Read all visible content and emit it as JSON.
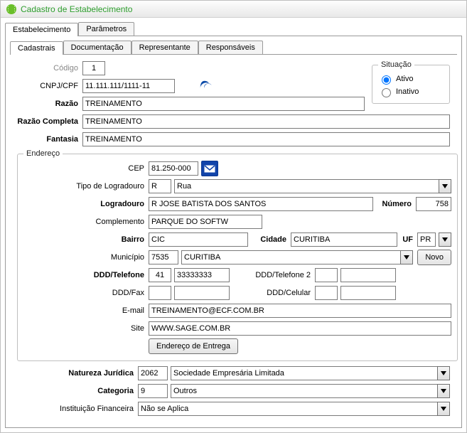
{
  "window": {
    "title": "Cadastro de Estabelecimento"
  },
  "outer_tabs": {
    "estabelecimento": "Estabelecimento",
    "parametros": "Parâmetros"
  },
  "inner_tabs": {
    "cadastrais": "Cadastrais",
    "documentacao": "Documentação",
    "representante": "Representante",
    "responsaveis": "Responsáveis"
  },
  "labels": {
    "codigo": "Código",
    "cnpj": "CNPJ/CPF",
    "razao": "Razão",
    "razao_completa": "Razão Completa",
    "fantasia": "Fantasia",
    "endereco": "Endereço",
    "cep": "CEP",
    "tipo_logradouro": "Tipo de Logradouro",
    "logradouro": "Logradouro",
    "numero": "Número",
    "complemento": "Complemento",
    "bairro": "Bairro",
    "cidade": "Cidade",
    "uf": "UF",
    "municipio": "Município",
    "ddd_telefone": "DDD/Telefone",
    "ddd_telefone2": "DDD/Telefone 2",
    "ddd_fax": "DDD/Fax",
    "ddd_celular": "DDD/Celular",
    "email": "E-mail",
    "site": "Site",
    "endereco_entrega": "Endereço de Entrega",
    "natureza": "Natureza Jurídica",
    "categoria": "Categoria",
    "instituicao": "Instituição Financeira",
    "situacao": "Situação",
    "ativo": "Ativo",
    "inativo": "Inativo",
    "novo": "Novo"
  },
  "values": {
    "codigo": "1",
    "cnpj": "11.111.111/1111-11",
    "razao": "TREINAMENTO",
    "razao_completa": "TREINAMENTO",
    "fantasia": "TREINAMENTO",
    "cep": "81.250-000",
    "tipo_logradouro_code": "R",
    "tipo_logradouro_desc": "Rua",
    "logradouro": "R JOSE BATISTA DOS SANTOS",
    "numero": "758",
    "complemento": "PARQUE DO SOFTW",
    "bairro": "CIC",
    "cidade": "CURITIBA",
    "uf": "PR",
    "municipio_code": "7535",
    "municipio_desc": "CURITIBA",
    "ddd": "41",
    "telefone": "33333333",
    "ddd2": "",
    "telefone2": "",
    "ddd_fax": "",
    "fax": "",
    "ddd_cel": "",
    "cel": "",
    "email": "TREINAMENTO@ECF.COM.BR",
    "site": "WWW.SAGE.COM.BR",
    "natureza_code": "2062",
    "natureza_desc": "Sociedade Empresária Limitada",
    "categoria_code": "9",
    "categoria_desc": "Outros",
    "instituicao": "Não se Aplica"
  }
}
